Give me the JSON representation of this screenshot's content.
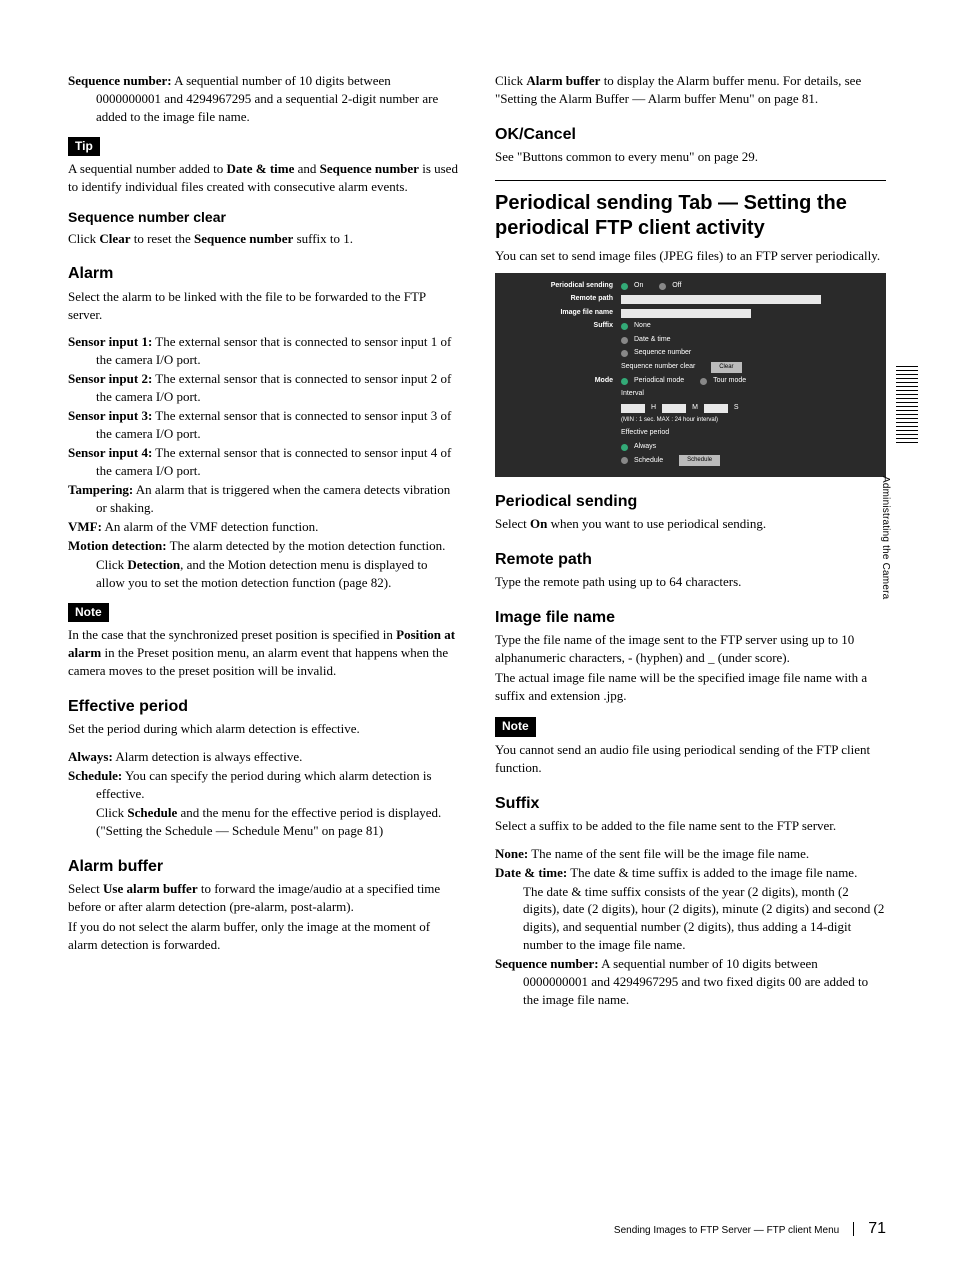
{
  "sideTab": "Administrating the Camera",
  "footer": {
    "title": "Sending Images to FTP Server — FTP client Menu",
    "page": "71"
  },
  "left": {
    "seqNum": {
      "label": "Sequence number:",
      "text": " A sequential number of 10 digits between 0000000001 and 4294967295 and a sequential 2-digit number are added to the image file name."
    },
    "tipLabel": "Tip",
    "tipText": {
      "p1a": "A sequential number added to ",
      "p1b": "Date & time",
      "p1c": " and ",
      "p1d": "Sequence number",
      "p1e": " is used to identify individual files created with consecutive alarm events."
    },
    "seqClearH": "Sequence number clear",
    "seqClear": {
      "a": "Click ",
      "b": "Clear",
      "c": " to reset the ",
      "d": "Sequence number",
      "e": " suffix to 1."
    },
    "alarmH": "Alarm",
    "alarmP": "Select the alarm to be linked with the file to be forwarded to the FTP server.",
    "si1": {
      "label": "Sensor input 1:",
      "text": " The external sensor that is connected to sensor input 1 of the camera I/O port."
    },
    "si2": {
      "label": "Sensor input 2:",
      "text": " The external sensor that is connected to sensor input 2 of the camera I/O port."
    },
    "si3": {
      "label": "Sensor input 3:",
      "text": " The external sensor that is connected to sensor input 3 of the camera I/O port."
    },
    "si4": {
      "label": "Sensor input 4:",
      "text": " The external sensor that is connected to sensor input 4 of the camera I/O port."
    },
    "tamp": {
      "label": "Tampering:",
      "text": " An alarm that is triggered when the camera detects vibration or shaking."
    },
    "vmf": {
      "label": "VMF:",
      "text": " An alarm of the VMF detection function."
    },
    "md": {
      "label": "Motion detection:",
      "text": " The alarm detected by the motion detection function."
    },
    "mdSub": {
      "a": "Click ",
      "b": "Detection",
      "c": ", and the Motion detection menu is displayed to allow you to set the motion detection function (page 82)."
    },
    "noteLabel": "Note",
    "noteText": {
      "a": "In the case that the synchronized preset position is specified in ",
      "b": "Position at alarm",
      "c": " in the Preset position menu, an alarm event that happens when the camera moves to the preset position will be invalid."
    },
    "effH": "Effective period",
    "effP": "Set the period during which alarm detection is effective.",
    "always": {
      "label": "Always:",
      "text": " Alarm detection is always effective."
    },
    "sched": {
      "label": "Schedule:",
      "text": " You can specify the period during which alarm detection is effective."
    },
    "schedSub": {
      "a": "Click ",
      "b": "Schedule",
      "c": " and the menu for the effective period is displayed. (\"Setting the Schedule — Schedule Menu\" on page 81)"
    },
    "abH": "Alarm buffer",
    "abP1": {
      "a": "Select ",
      "b": "Use alarm buffer",
      "c": " to forward the image/audio at a specified time before or after alarm detection (pre-alarm, post-alarm)."
    },
    "abP2": "If you do not select the alarm buffer, only the image at the moment of alarm detection is forwarded."
  },
  "right": {
    "abLink": {
      "a": "Click ",
      "b": "Alarm buffer",
      "c": " to display the Alarm buffer menu. For details, see \"Setting the Alarm Buffer — Alarm buffer Menu\" on page 81."
    },
    "okH": "OK/Cancel",
    "okP": "See \"Buttons common to every menu\" on page 29.",
    "mainH": "Periodical sending Tab — Setting the periodical FTP client activity",
    "mainP": "You can set to send image files (JPEG files) to an FTP server periodically.",
    "shot": {
      "psLabel": "Periodical sending",
      "on": "On",
      "off": "Off",
      "remote": "Remote path",
      "ifn": "Image file name",
      "suffix": "Suffix",
      "none": "None",
      "dt": "Date & time",
      "sn": "Sequence number",
      "snc": "Sequence number clear",
      "clear": "Clear",
      "mode": "Mode",
      "pmode": "Periodical mode",
      "tmode": "Tour mode",
      "interval": "Interval",
      "h": "H",
      "m": "M",
      "s": "S",
      "range": "(MIN : 1 sec. MAX : 24 hour interval)",
      "ep": "Effective period",
      "always": "Always",
      "schedule": "Schedule",
      "schedBtn": "Schedule"
    },
    "psH": "Periodical sending",
    "psP": {
      "a": "Select ",
      "b": "On",
      "c": " when you want to use periodical sending."
    },
    "rpH": "Remote path",
    "rpP": "Type the remote path using up to 64 characters.",
    "ifnH": "Image file name",
    "ifnP1": "Type the file name of the image sent to the FTP server using up to 10 alphanumeric characters, - (hyphen) and _ (under score).",
    "ifnP2": "The actual image file name will be the specified image file name with a suffix and extension .jpg.",
    "noteLabel": "Note",
    "noteP": "You cannot send an audio file using periodical sending of the FTP client function.",
    "sufH": "Suffix",
    "sufP": "Select a suffix to be added to the file name sent to the FTP server.",
    "sNone": {
      "label": "None:",
      "text": " The name of the sent file will be the image file name."
    },
    "sDT": {
      "label": "Date & time:",
      "text": " The date & time suffix is added to the image file name."
    },
    "sDTsub": "The date & time suffix consists of the year (2 digits), month (2 digits), date (2 digits), hour (2 digits), minute (2 digits) and second (2 digits), and sequential number (2 digits), thus adding a 14-digit number to the image file name.",
    "sSN": {
      "label": "Sequence number:",
      "text": " A sequential number of 10 digits between 0000000001 and 4294967295 and two fixed digits 00 are added to the image file name."
    }
  }
}
